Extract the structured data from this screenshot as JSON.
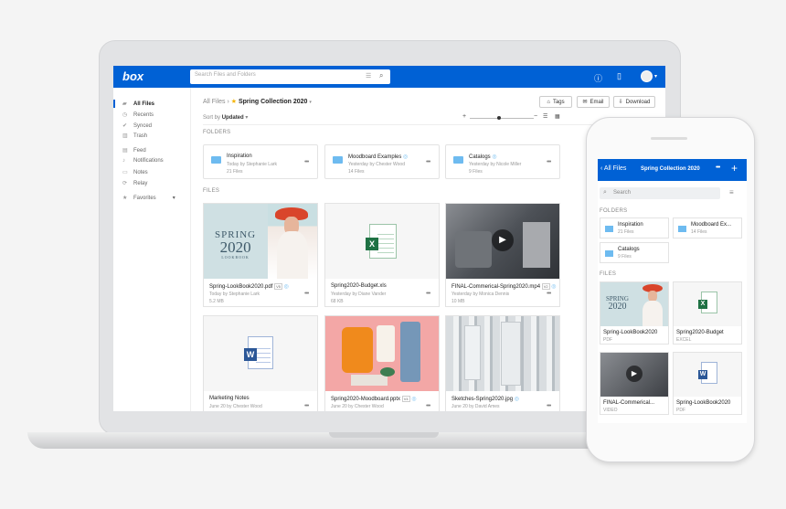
{
  "app": {
    "logo": "box",
    "search_placeholder": "Search Files and Folders"
  },
  "sidebar": {
    "items": [
      {
        "label": "All Files",
        "icon": "folder-icon"
      },
      {
        "label": "Recents",
        "icon": "clock-icon"
      },
      {
        "label": "Synced",
        "icon": "check-icon"
      },
      {
        "label": "Trash",
        "icon": "trash-icon"
      },
      {
        "label": "Feed",
        "icon": "feed-icon"
      },
      {
        "label": "Notifications",
        "icon": "bell-icon"
      },
      {
        "label": "Notes",
        "icon": "note-icon"
      },
      {
        "label": "Relay",
        "icon": "relay-icon"
      },
      {
        "label": "Favorites",
        "icon": "star-icon"
      }
    ]
  },
  "breadcrumb": {
    "root": "All Files",
    "current": "Spring Collection 2020"
  },
  "toolbar": {
    "tags": "Tags",
    "email": "Email",
    "download": "Download"
  },
  "sort": {
    "prefix": "Sort by",
    "value": "Updated"
  },
  "sections": {
    "folders": "FOLDERS",
    "files": "FILES"
  },
  "folders": [
    {
      "name": "Inspiration",
      "updated": "Today by Stephanie Lark",
      "count": "21 Files"
    },
    {
      "name": "Moodboard Examples",
      "updated": "Yesterday by Chester Wood",
      "count": "14 Files"
    },
    {
      "name": "Catalogs",
      "updated": "Yesterday by Nicole Miller",
      "count": "9 Files"
    }
  ],
  "files": [
    {
      "name": "Spring-LookBook2020.pdf",
      "badge": "V5",
      "updated": "Today by Stephanie Lark",
      "size": "5.2 MB",
      "thumb_title": "SPRING",
      "thumb_year": "2020",
      "thumb_sub": "LOOKBOOK"
    },
    {
      "name": "Spring2020-Budget.xls",
      "badge": "",
      "updated": "Yesterday by Diane Vander",
      "size": "68 KB"
    },
    {
      "name": "FINAL-Commerical-Spring2020.mp4",
      "badge": "V2",
      "updated": "Yesterday by Monica Dennis",
      "size": "10 MB"
    },
    {
      "name": "Marketing Notes",
      "badge": "",
      "updated": "June 20 by Chester Wood",
      "size": ""
    },
    {
      "name": "Spring2020-Moodboard.pptx",
      "badge": "V4",
      "updated": "June 20 by Chester Wood",
      "size": ""
    },
    {
      "name": "Sketches-Spring2020.jpg",
      "badge": "",
      "updated": "June 20 by David Ames",
      "size": ""
    }
  ],
  "mobile": {
    "back": "All Files",
    "title": "Spring Collection 2020",
    "search": "Search",
    "folders_label": "FOLDERS",
    "files_label": "FILES",
    "folders": [
      {
        "name": "Inspiration",
        "count": "21 Files"
      },
      {
        "name": "Moodboard Ex...",
        "count": "14 Files"
      },
      {
        "name": "Catalogs",
        "count": "9 Files"
      }
    ],
    "files": [
      {
        "name": "Spring-LookBook2020",
        "type": "PDF"
      },
      {
        "name": "Spring2020-Budget",
        "type": "EXCEL"
      },
      {
        "name": "FINAL-Commerical...",
        "type": "VIDEO"
      },
      {
        "name": "Spring-LookBook2020",
        "type": "PDF"
      }
    ]
  },
  "colors": {
    "brand": "#0061d5",
    "folder": "#6ebbf0",
    "excel": "#1f7244",
    "word": "#2b5797"
  }
}
